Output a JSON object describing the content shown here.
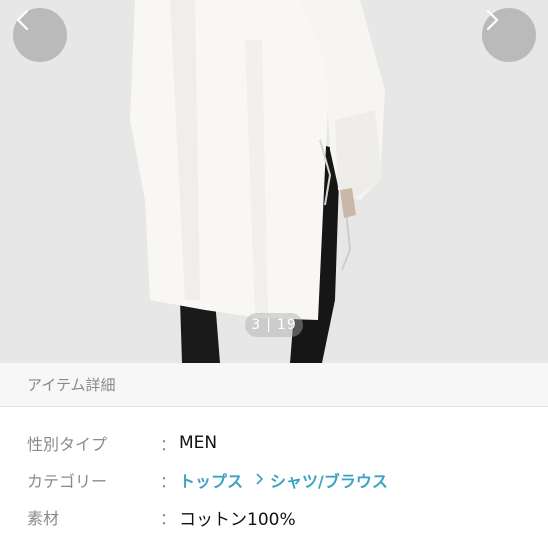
{
  "gallery": {
    "current": "3",
    "separator": "|",
    "total": "19",
    "prev_icon": "chevron-left-icon",
    "next_icon": "chevron-right-icon"
  },
  "section": {
    "title": "アイテム詳細"
  },
  "details": {
    "gender_label": "性別タイプ",
    "gender_value": "MEN",
    "category_label": "カテゴリー",
    "category_link_1": "トップス",
    "category_link_2": "シャツ/ブラウス",
    "material_label": "素材",
    "material_value": "コットン100%",
    "colon": "："
  },
  "colors": {
    "link": "#3aa2c4",
    "label": "#8a8a8a",
    "header_bg": "#f7f7f7"
  }
}
